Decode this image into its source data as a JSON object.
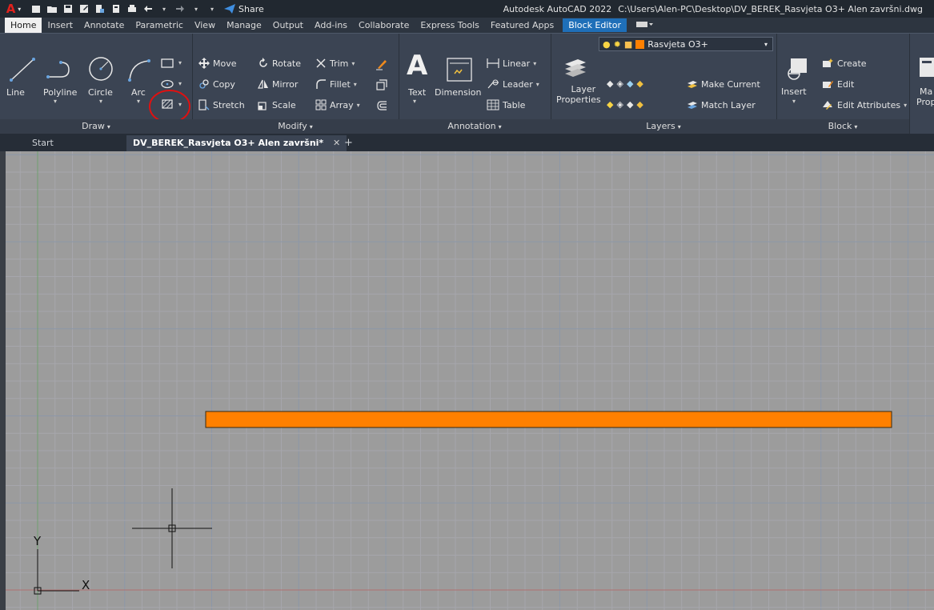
{
  "app": {
    "title": "Autodesk AutoCAD 2022",
    "path": "C:\\Users\\Alen-PC\\Desktop\\DV_BEREK_Rasvjeta O3+ Alen završni.dwg",
    "share_label": "Share"
  },
  "ribbon_tabs": [
    {
      "label": "Home",
      "active": true
    },
    {
      "label": "Insert"
    },
    {
      "label": "Annotate"
    },
    {
      "label": "Parametric"
    },
    {
      "label": "View"
    },
    {
      "label": "Manage"
    },
    {
      "label": "Output"
    },
    {
      "label": "Add-ins"
    },
    {
      "label": "Collaborate"
    },
    {
      "label": "Express Tools"
    },
    {
      "label": "Featured Apps"
    },
    {
      "label": "Block Editor",
      "highlighted": true
    }
  ],
  "panels": {
    "draw": {
      "title": "Draw",
      "line": "Line",
      "polyline": "Polyline",
      "circle": "Circle",
      "arc": "Arc"
    },
    "modify": {
      "title": "Modify",
      "move": "Move",
      "rotate": "Rotate",
      "trim": "Trim",
      "copy": "Copy",
      "mirror": "Mirror",
      "fillet": "Fillet",
      "stretch": "Stretch",
      "scale": "Scale",
      "array": "Array"
    },
    "annotation": {
      "title": "Annotation",
      "text": "Text",
      "dimension": "Dimension",
      "linear": "Linear",
      "leader": "Leader",
      "table": "Table"
    },
    "layers": {
      "title": "Layers",
      "layer_properties_1": "Layer",
      "layer_properties_2": "Properties",
      "current_layer": "Rasvjeta O3+",
      "make_current": "Make Current",
      "match_layer": "Match Layer"
    },
    "block": {
      "title": "Block",
      "insert": "Insert",
      "create": "Create",
      "edit": "Edit",
      "edit_attributes": "Edit Attributes"
    },
    "cut": {
      "label_1": "Ma",
      "label_2": "Prop"
    }
  },
  "file_tabs": {
    "start": "Start",
    "active": "DV_BEREK_Rasvjeta O3+ Alen završni*",
    "close": "✕",
    "new": "+"
  },
  "ucs": {
    "x_label": "X",
    "y_label": "Y"
  },
  "colors": {
    "layer_color": "#ff8000",
    "annotation_circle": "#e01010",
    "canvas_bg": "#9c9c9c"
  }
}
